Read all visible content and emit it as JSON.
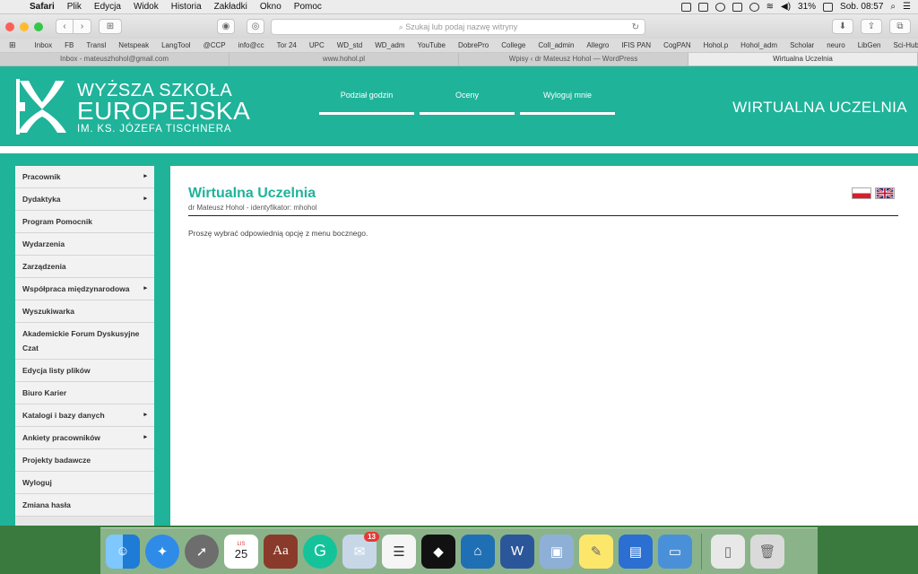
{
  "menubar": {
    "app": "Safari",
    "items": [
      "Plik",
      "Edycja",
      "Widok",
      "Historia",
      "Zakładki",
      "Okno",
      "Pomoc"
    ],
    "battery": "31%",
    "clock": "Sob. 08:57"
  },
  "browser": {
    "address_placeholder": "Szukaj lub podaj nazwę witryny",
    "bookmarks": [
      "Inbox",
      "FB",
      "Transl",
      "Netspeak",
      "LangTool",
      "@CCP",
      "info@cc",
      "Tor 24",
      "UPC",
      "WD_std",
      "WD_adm",
      "YouTube",
      "DobrePro",
      "College",
      "Coll_admin",
      "Allegro",
      "IFIS PAN",
      "CogPAN",
      "Hohol.p",
      "Hohol_adm",
      "Scholar",
      "neuro",
      "LibGen",
      "Sci-Hub"
    ],
    "tabs": [
      "Inbox - mateuszhohol@gmail.com",
      "www.hohol.pl",
      "Wpisy ‹ dr Mateusz Hohol — WordPress",
      "Wirtualna Uczelnia"
    ],
    "active_tab": 3
  },
  "site": {
    "logo": {
      "line1": "WYŻSZA SZKOŁA",
      "line2": "EUROPEJSKA",
      "line3": "IM. KS. JÓZEFA TISCHNERA"
    },
    "topnav": [
      "Podział godzin",
      "Oceny",
      "Wyloguj mnie"
    ],
    "title": "WIRTUALNA UCZELNIA",
    "brand_color": "#1fb39a"
  },
  "sidebar": {
    "items": [
      {
        "label": "Pracownik",
        "arrow": "▸"
      },
      {
        "label": "Dydaktyka",
        "arrow": "▸"
      },
      {
        "label": "Program Pomocnik",
        "arrow": ""
      },
      {
        "label": "Wydarzenia",
        "arrow": ""
      },
      {
        "label": "Zarządzenia",
        "arrow": ""
      },
      {
        "label": "Współpraca międzynarodowa",
        "arrow": "▸"
      },
      {
        "label": "Wyszukiwarka",
        "arrow": ""
      },
      {
        "label": "Akademickie Forum Dyskusyjne Czat",
        "arrow": ""
      },
      {
        "label": "Edycja listy plików",
        "arrow": ""
      },
      {
        "label": "Biuro Karier",
        "arrow": ""
      },
      {
        "label": "Katalogi i bazy danych",
        "arrow": "▸"
      },
      {
        "label": "Ankiety pracowników",
        "arrow": "▸"
      },
      {
        "label": "Projekty badawcze",
        "arrow": ""
      },
      {
        "label": "Wyloguj",
        "arrow": ""
      },
      {
        "label": "Zmiana hasła",
        "arrow": ""
      }
    ]
  },
  "main": {
    "heading": "Wirtualna Uczelnia",
    "subheading": "dr Mateusz Hohol - identyfikator: mhohol",
    "message": "Proszę wybrać odpowiednią opcję z menu bocznego."
  },
  "dock": {
    "calendar_month": "LIS",
    "calendar_day": "25",
    "mail_badge": "13"
  }
}
